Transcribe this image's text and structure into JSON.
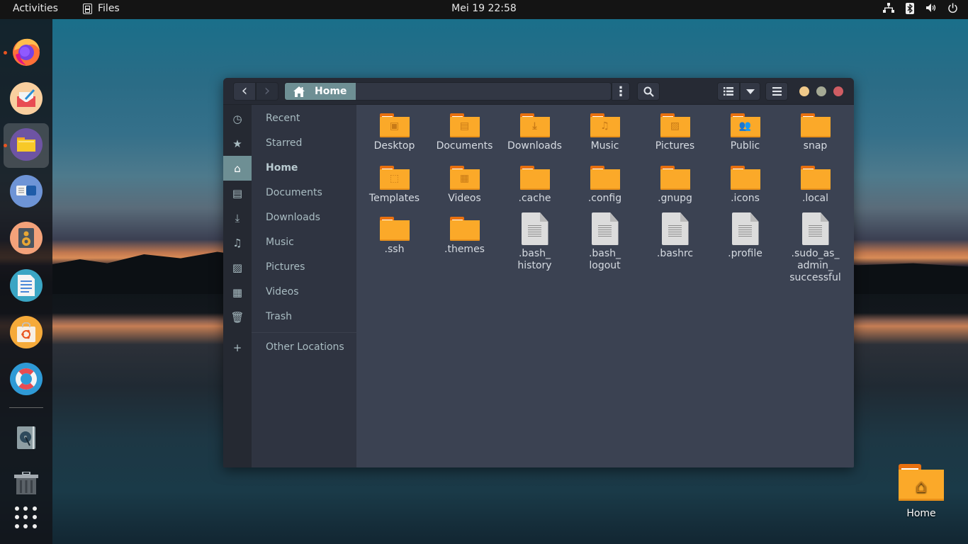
{
  "topbar": {
    "activities_label": "Activities",
    "app_name": "Files",
    "app_icon": "file-cabinet-icon",
    "clock": "Mei 19  22:58",
    "status_icons": [
      "network-icon",
      "bluetooth-icon",
      "volume-icon",
      "power-icon"
    ]
  },
  "dock": {
    "apps": [
      {
        "name": "Firefox",
        "icon": "firefox-icon",
        "running": true,
        "active": false
      },
      {
        "name": "Mail",
        "icon": "mail-icon",
        "running": false,
        "active": false
      },
      {
        "name": "Files",
        "icon": "files-icon",
        "running": true,
        "active": true
      },
      {
        "name": "Toggle",
        "icon": "toggle-app-icon",
        "running": false,
        "active": false
      },
      {
        "name": "Speaker",
        "icon": "speaker-icon",
        "running": false,
        "active": false
      },
      {
        "name": "Text Editor",
        "icon": "text-editor-icon",
        "running": false,
        "active": false
      },
      {
        "name": "Ubuntu Software",
        "icon": "software-center-icon",
        "running": false,
        "active": false
      },
      {
        "name": "Help",
        "icon": "lifebuoy-icon",
        "running": false,
        "active": false
      }
    ],
    "extras": [
      {
        "name": "Disk",
        "icon": "disk-icon"
      },
      {
        "name": "Trash",
        "icon": "trash-icon"
      },
      {
        "name": "Show Applications",
        "icon": "app-grid-icon"
      }
    ]
  },
  "window": {
    "path": {
      "current": "Home",
      "icon": "home-icon"
    },
    "buttons": {
      "back": "‹",
      "forward": "›",
      "menu_dots": "⋮",
      "search": "search-icon",
      "view_list": "list-view-icon",
      "view_dropdown": "chevron-down-icon",
      "hamburger": "hamburger-menu-icon"
    },
    "traffic_lights": {
      "minimize": "#f0c98a",
      "maximize": "#a5a994",
      "close": "#cf5d63"
    },
    "accent": "#6e8f94",
    "sidebar": [
      {
        "label": "Recent",
        "icon": "clock-icon",
        "glyph": "◷",
        "active": false
      },
      {
        "label": "Starred",
        "icon": "star-icon",
        "glyph": "★",
        "active": false
      },
      {
        "label": "Home",
        "icon": "home-icon",
        "glyph": "⌂",
        "active": true
      },
      {
        "label": "Documents",
        "icon": "document-icon",
        "glyph": "▤",
        "active": false
      },
      {
        "label": "Downloads",
        "icon": "download-icon",
        "glyph": "⤓",
        "active": false
      },
      {
        "label": "Music",
        "icon": "music-note-icon",
        "glyph": "♫",
        "active": false
      },
      {
        "label": "Pictures",
        "icon": "picture-icon",
        "glyph": "▨",
        "active": false
      },
      {
        "label": "Videos",
        "icon": "film-icon",
        "glyph": "▦",
        "active": false
      },
      {
        "label": "Trash",
        "icon": "trash-icon",
        "glyph": "🗑",
        "active": false
      },
      {
        "label": "Other Locations",
        "icon": "plus-icon",
        "glyph": "+",
        "active": false
      }
    ],
    "files": [
      {
        "name": "Desktop",
        "type": "folder",
        "emblem": "▣",
        "emblem_icon": "monitor-icon"
      },
      {
        "name": "Documents",
        "type": "folder",
        "emblem": "▤",
        "emblem_icon": "document-icon"
      },
      {
        "name": "Downloads",
        "type": "folder",
        "emblem": "⤓",
        "emblem_icon": "download-icon"
      },
      {
        "name": "Music",
        "type": "folder",
        "emblem": "♫",
        "emblem_icon": "music-note-icon"
      },
      {
        "name": "Pictures",
        "type": "folder",
        "emblem": "▨",
        "emblem_icon": "picture-icon"
      },
      {
        "name": "Public",
        "type": "folder",
        "emblem": "👥",
        "emblem_icon": "people-icon"
      },
      {
        "name": "snap",
        "type": "folder",
        "emblem": "",
        "emblem_icon": ""
      },
      {
        "name": "Templates",
        "type": "folder",
        "emblem": "⬚",
        "emblem_icon": "template-icon"
      },
      {
        "name": "Videos",
        "type": "folder",
        "emblem": "▦",
        "emblem_icon": "film-icon"
      },
      {
        "name": ".cache",
        "type": "folder",
        "emblem": "",
        "emblem_icon": ""
      },
      {
        "name": ".config",
        "type": "folder",
        "emblem": "",
        "emblem_icon": ""
      },
      {
        "name": ".gnupg",
        "type": "folder",
        "emblem": "",
        "emblem_icon": ""
      },
      {
        "name": ".icons",
        "type": "folder",
        "emblem": "",
        "emblem_icon": ""
      },
      {
        "name": ".local",
        "type": "folder",
        "emblem": "",
        "emblem_icon": ""
      },
      {
        "name": ".ssh",
        "type": "folder",
        "emblem": "",
        "emblem_icon": ""
      },
      {
        "name": ".themes",
        "type": "folder",
        "emblem": "",
        "emblem_icon": ""
      },
      {
        "name": ".bash_\nhistory",
        "type": "file"
      },
      {
        "name": ".bash_\nlogout",
        "type": "file"
      },
      {
        "name": ".bashrc",
        "type": "file"
      },
      {
        "name": ".profile",
        "type": "file"
      },
      {
        "name": ".sudo_as_\nadmin_\nsuccessful",
        "type": "file"
      }
    ]
  },
  "desktop": {
    "icons": [
      {
        "label": "Home",
        "icon": "home-folder-icon",
        "emblem": "⌂"
      }
    ]
  }
}
